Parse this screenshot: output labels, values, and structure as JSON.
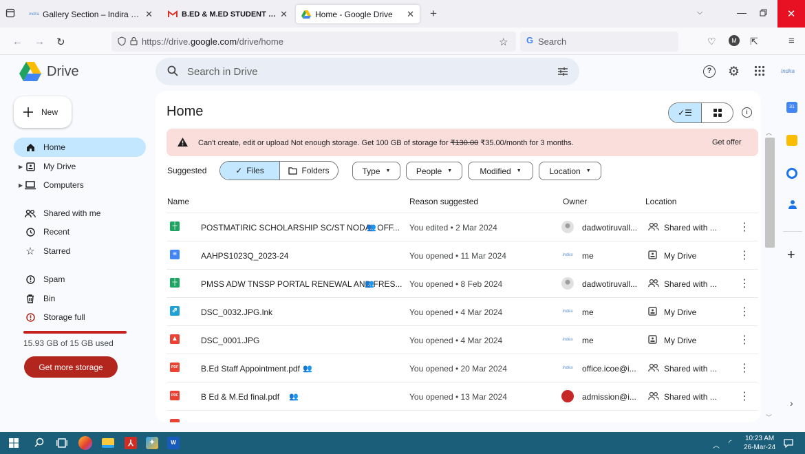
{
  "browser": {
    "tabs": [
      {
        "title": "Gallery Section – Indira Educatio",
        "active": false
      },
      {
        "title": "B.ED & M.ED STUDENT DETAILS",
        "active": false
      },
      {
        "title": "Home - Google Drive",
        "active": true
      }
    ],
    "url_prefix": "https://drive.",
    "url_domain": "google.com",
    "url_path": "/drive/home",
    "search_placeholder": "Search"
  },
  "drive": {
    "product_name": "Drive",
    "search_placeholder": "Search in Drive",
    "new_label": "New",
    "nav": [
      {
        "label": "Home",
        "icon": "home-icon",
        "active": true
      },
      {
        "label": "My Drive",
        "icon": "my-drive-icon",
        "active": false
      },
      {
        "label": "Computers",
        "icon": "computer-icon",
        "active": false
      },
      {
        "label": "Shared with me",
        "icon": "shared-icon",
        "active": false
      },
      {
        "label": "Recent",
        "icon": "clock-icon",
        "active": false
      },
      {
        "label": "Starred",
        "icon": "star-icon",
        "active": false
      },
      {
        "label": "Spam",
        "icon": "spam-icon",
        "active": false
      },
      {
        "label": "Bin",
        "icon": "bin-icon",
        "active": false
      },
      {
        "label": "Storage full",
        "icon": "alert-icon",
        "active": false
      }
    ],
    "storage_text": "15.93 GB of 15 GB used",
    "storage_fraction": 1.0,
    "storage_button": "Get more storage",
    "page_title": "Home",
    "banner": {
      "text_pre": "Can't create, edit or upload Not enough storage. Get 100 GB of storage for ",
      "old_price": "₹130.00",
      "text_post": " ₹35.00/month for 3 months.",
      "action": "Get offer"
    },
    "suggested_label": "Suggested",
    "segment": {
      "files": "Files",
      "folders": "Folders"
    },
    "filters": [
      "Type",
      "People",
      "Modified",
      "Location"
    ],
    "columns": {
      "name": "Name",
      "reason": "Reason suggested",
      "owner": "Owner",
      "location": "Location"
    },
    "files": [
      {
        "name": "POSTMATIRIC SCHOLARSHIP SC/ST NODAL OFF...",
        "type": "sheet",
        "shared": true,
        "reason": "You edited • 2 Mar 2024",
        "owner": "dadwotiruvall...",
        "owner_avatar": "gov",
        "location": "Shared with ...",
        "loc_icon": "shared"
      },
      {
        "name": "AAHPS1023Q_2023-24",
        "type": "doc",
        "shared": false,
        "reason": "You opened • 11 Mar 2024",
        "owner": "me",
        "owner_avatar": "indira",
        "location": "My Drive",
        "loc_icon": "drive"
      },
      {
        "name": "PMSS ADW TNSSP PORTAL RENEWAL AND FRES...",
        "type": "sheet",
        "shared": true,
        "reason": "You opened • 8 Feb 2024",
        "owner": "dadwotiruvall...",
        "owner_avatar": "gov",
        "location": "Shared with ...",
        "loc_icon": "shared"
      },
      {
        "name": "DSC_0032.JPG.lnk",
        "type": "link",
        "shared": false,
        "reason": "You opened • 4 Mar 2024",
        "owner": "me",
        "owner_avatar": "indira",
        "location": "My Drive",
        "loc_icon": "drive"
      },
      {
        "name": "DSC_0001.JPG",
        "type": "image",
        "shared": false,
        "reason": "You opened • 4 Mar 2024",
        "owner": "me",
        "owner_avatar": "indira",
        "location": "My Drive",
        "loc_icon": "drive"
      },
      {
        "name": "B.Ed Staff Appointment.pdf",
        "type": "pdf",
        "shared": true,
        "reason": "You opened • 20 Mar 2024",
        "owner": "office.icoe@i...",
        "owner_avatar": "indira",
        "location": "Shared with ...",
        "loc_icon": "shared"
      },
      {
        "name": "B Ed & M.Ed final.pdf",
        "type": "pdf",
        "shared": true,
        "reason": "You opened • 13 Mar 2024",
        "owner": "admission@i...",
        "owner_avatar": "red",
        "location": "Shared with ...",
        "loc_icon": "shared"
      }
    ],
    "avatar_text": "Indira"
  },
  "taskbar": {
    "time": "10:23 AM",
    "date": "26-Mar-24"
  },
  "colors": {
    "accent": "#c2e7ff",
    "banner": "#f9dedc",
    "danger": "#b3261e",
    "taskbar": "#1b5e7a"
  }
}
